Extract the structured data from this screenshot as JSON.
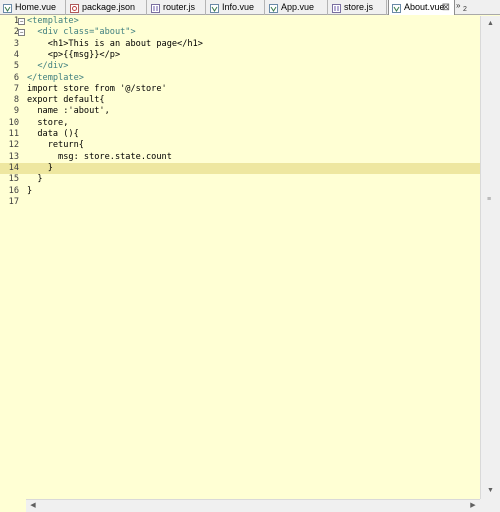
{
  "tabs": [
    {
      "label": "Home.vue",
      "icon": "vue-file-icon",
      "active": false
    },
    {
      "label": "package.json",
      "icon": "json-file-icon",
      "active": false
    },
    {
      "label": "router.js",
      "icon": "js-file-icon",
      "active": false
    },
    {
      "label": "Info.vue",
      "icon": "vue-file-icon",
      "active": false
    },
    {
      "label": "App.vue",
      "icon": "vue-file-icon",
      "active": false
    },
    {
      "label": "store.js",
      "icon": "js-file-icon",
      "active": false
    },
    {
      "label": "About.vue",
      "icon": "vue-file-icon",
      "active": true
    }
  ],
  "close_glyph": "⊠",
  "overflow": {
    "glyph": "»",
    "count": "2"
  },
  "editor": {
    "current_line": 14,
    "line_numbers": [
      "1",
      "2",
      "3",
      "4",
      "5",
      "6",
      "7",
      "8",
      "9",
      "10",
      "11",
      "12",
      "13",
      "14",
      "15",
      "16",
      "17"
    ],
    "fold_markers": {
      "1": "−",
      "2": "−"
    },
    "lines": [
      "<template>",
      "  <div class=\"about\">",
      "    <h1>This is an about page</h1>",
      "    <p>{{msg}}</p>",
      "  </div>",
      "</template>",
      "import store from '@/store'",
      "export default{",
      "  name :'about',",
      "  store,",
      "  data (){",
      "    return{",
      "      msg: store.state.count",
      "    }",
      "  }",
      "}",
      ""
    ]
  },
  "scrollbar": {
    "up": "▲",
    "down": "▼",
    "left": "◀",
    "right": "▶",
    "grip": "≡"
  },
  "colors": {
    "editor_bg": "#ffffd4",
    "current_line": "#eee7a0",
    "tag": "#3f7f7f",
    "attr": "#7f007f",
    "string": "#2a00ff"
  }
}
